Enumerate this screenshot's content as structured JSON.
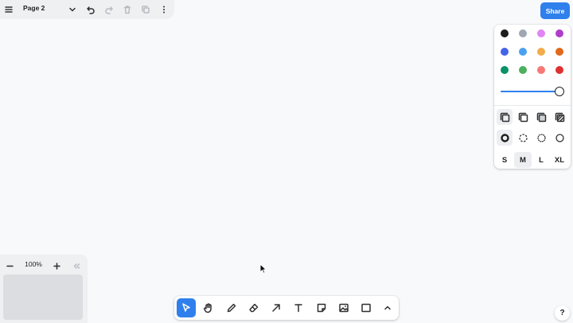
{
  "menu": {
    "page_name": "Page 2"
  },
  "share": {
    "label": "Share"
  },
  "style_panel": {
    "colors": [
      {
        "name": "black",
        "hex": "#1d1d1d"
      },
      {
        "name": "grey",
        "hex": "#9fa8b2"
      },
      {
        "name": "light-violet",
        "hex": "#e085f4"
      },
      {
        "name": "violet",
        "hex": "#ae3ec9"
      },
      {
        "name": "blue",
        "hex": "#4465e9"
      },
      {
        "name": "light-blue",
        "hex": "#4ba1f1"
      },
      {
        "name": "yellow",
        "hex": "#f1ac4b"
      },
      {
        "name": "orange",
        "hex": "#e16919"
      },
      {
        "name": "green",
        "hex": "#099268"
      },
      {
        "name": "light-green",
        "hex": "#4cb05e"
      },
      {
        "name": "light-red",
        "hex": "#f87777"
      },
      {
        "name": "red",
        "hex": "#e03131"
      }
    ],
    "opacity": 1.0,
    "selected_color": "black",
    "sizes": [
      "S",
      "M",
      "L",
      "XL"
    ],
    "selected_size": "M"
  },
  "zoom": {
    "value": "100%"
  },
  "help": {
    "label": "?"
  },
  "accent": "#2f80ed"
}
